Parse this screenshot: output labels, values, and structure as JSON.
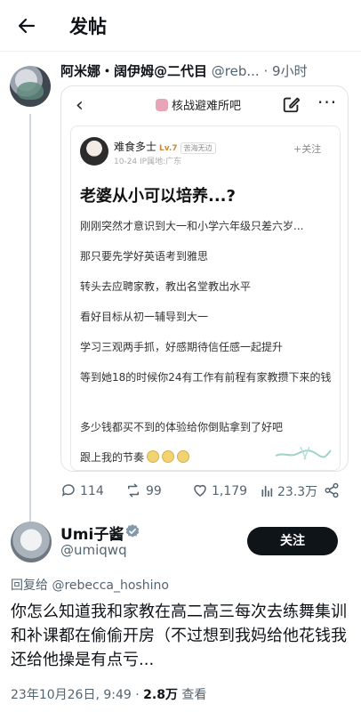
{
  "header": {
    "title": "发帖",
    "back_icon": "arrow-left-icon"
  },
  "parent": {
    "author_name": "阿米娜・阔伊姆@二代目",
    "author_handle": "@reb...",
    "time": "· 9小时",
    "embed": {
      "forum": "核战避难所吧",
      "post": {
        "user": "难食多士",
        "level": "Lv.7",
        "badge": "苦海无边",
        "meta": "10-24  IP属地:广东",
        "follow": "+关注",
        "headline": "老婆从小可以培养...?",
        "lines": [
          "刚刚突然才意识到大一和小学六年级只差六岁...",
          "那只要先学好英语考到雅思",
          "转头去应聘家教，教出名堂教出水平",
          "看好目标从初一辅导到大一",
          "学习三观两手抓，好感期待信任感一起提升",
          "等到她18的时候你24有工作有前程有家教攒下来的钱",
          "多少钱都买不到的体验给你倒贴拿到了好吧",
          "跟上我的节奏"
        ]
      }
    },
    "stats": {
      "replies": "114",
      "reposts": "99",
      "likes": "1,179",
      "views": "23.3万"
    }
  },
  "reply": {
    "name": "Umi子酱",
    "handle": "@umiqwq",
    "follow_label": "关注",
    "replying_prefix": "回复给 ",
    "replying_to": "@rebecca_hoshino",
    "text": "你怎么知道我和家教在高二高三每次去练舞集训和补课都在偷偷开房（不过想到我妈给他花钱我还给他操是有点亏...",
    "date": "23年10月26日, 9:49 · ",
    "views": "2.8万",
    "views_suffix": " 查看"
  },
  "colors": {
    "text": "#0f1419",
    "muted": "#536471",
    "verified": "#829aab",
    "button_bg": "#0f1419"
  }
}
